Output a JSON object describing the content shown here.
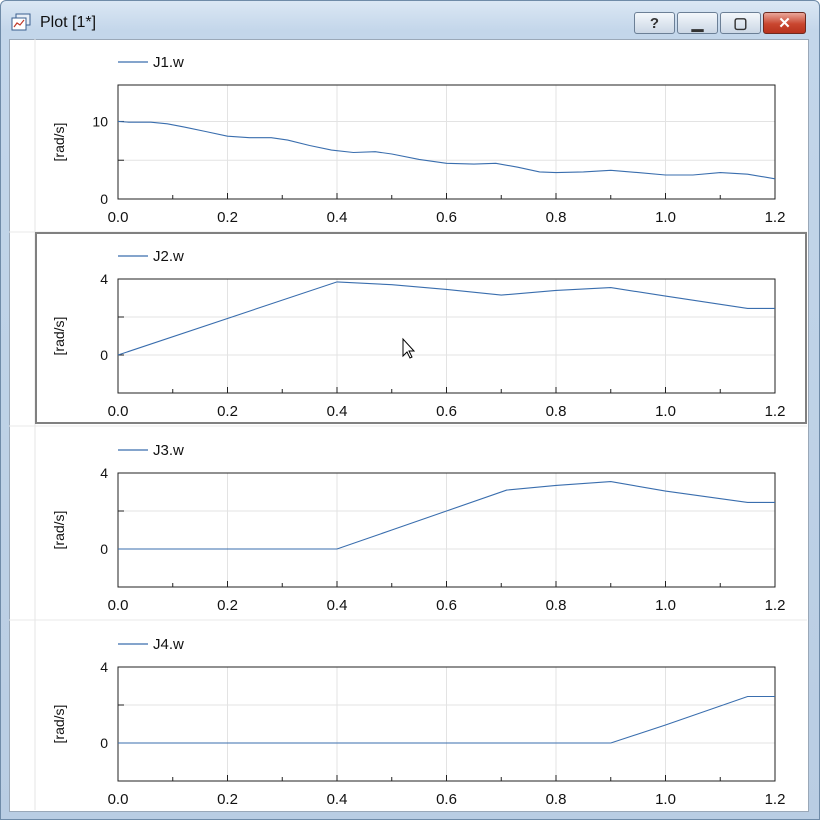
{
  "window": {
    "title": "Plot [1*]",
    "buttons": {
      "help": "?",
      "minimize": "▁",
      "maximize": "▢",
      "close": "✕"
    }
  },
  "colors": {
    "line": "#3a6eae",
    "grid": "#e3e3e3",
    "axis": "#222222",
    "selected_border": "#808080"
  },
  "chart_data": [
    {
      "type": "line",
      "series": [
        {
          "name": "J1.w",
          "x": [
            0,
            0.02,
            0.06,
            0.09,
            0.12,
            0.16,
            0.2,
            0.24,
            0.28,
            0.31,
            0.35,
            0.39,
            0.43,
            0.47,
            0.5,
            0.55,
            0.6,
            0.65,
            0.69,
            0.73,
            0.77,
            0.8,
            0.85,
            0.9,
            0.95,
            1.0,
            1.05,
            1.1,
            1.15,
            1.2
          ],
          "y": [
            10,
            9.9,
            9.9,
            9.7,
            9.3,
            8.7,
            8.1,
            7.9,
            7.9,
            7.6,
            6.9,
            6.3,
            6.0,
            6.1,
            5.8,
            5.1,
            4.6,
            4.5,
            4.6,
            4.1,
            3.5,
            3.4,
            3.5,
            3.7,
            3.4,
            3.1,
            3.1,
            3.4,
            3.2,
            2.6
          ]
        }
      ],
      "ylabel": "[rad/s]",
      "ylim": [
        0,
        14.7
      ],
      "yticks": [
        0,
        10
      ],
      "ytick_labels": [
        "0",
        "10"
      ],
      "xlim": [
        0,
        1.2
      ],
      "xticks": [
        "0.0",
        "0.2",
        "0.4",
        "0.6",
        "0.8",
        "1.0",
        "1.2"
      ],
      "grid": true,
      "legend": "top-left"
    },
    {
      "type": "line",
      "series": [
        {
          "name": "J2.w",
          "x": [
            0,
            0.4,
            0.5,
            0.6,
            0.7,
            0.8,
            0.9,
            1.0,
            1.15,
            1.2
          ],
          "y": [
            0,
            3.85,
            3.7,
            3.45,
            3.15,
            3.4,
            3.55,
            3.1,
            2.45,
            2.45
          ]
        }
      ],
      "ylabel": "[rad/s]",
      "ylim": [
        -2,
        4
      ],
      "yticks": [
        0,
        4
      ],
      "ytick_labels": [
        "0",
        "4"
      ],
      "xlim": [
        0,
        1.2
      ],
      "xticks": [
        "0.0",
        "0.2",
        "0.4",
        "0.6",
        "0.8",
        "1.0",
        "1.2"
      ],
      "grid": true,
      "legend": "top-left"
    },
    {
      "type": "line",
      "series": [
        {
          "name": "J3.w",
          "x": [
            0,
            0.4,
            0.5,
            0.6,
            0.71,
            0.8,
            0.9,
            1.0,
            1.15,
            1.2
          ],
          "y": [
            0,
            0,
            1.0,
            2.0,
            3.1,
            3.35,
            3.55,
            3.05,
            2.45,
            2.45
          ]
        }
      ],
      "ylabel": "[rad/s]",
      "ylim": [
        -2,
        4
      ],
      "yticks": [
        0,
        4
      ],
      "ytick_labels": [
        "0",
        "4"
      ],
      "xlim": [
        0,
        1.2
      ],
      "xticks": [
        "0.0",
        "0.2",
        "0.4",
        "0.6",
        "0.8",
        "1.0",
        "1.2"
      ],
      "grid": true,
      "legend": "top-left"
    },
    {
      "type": "line",
      "series": [
        {
          "name": "J4.w",
          "x": [
            0,
            0.4,
            0.6,
            0.9,
            1.0,
            1.15,
            1.2
          ],
          "y": [
            0,
            0,
            0,
            0,
            0.95,
            2.45,
            2.45
          ]
        }
      ],
      "ylabel": "[rad/s]",
      "ylim": [
        -2,
        4
      ],
      "yticks": [
        0,
        4
      ],
      "ytick_labels": [
        "0",
        "4"
      ],
      "xlim": [
        0,
        1.2
      ],
      "xticks": [
        "0.0",
        "0.2",
        "0.4",
        "0.6",
        "0.8",
        "1.0",
        "1.2"
      ],
      "grid": true,
      "legend": "top-left"
    }
  ]
}
